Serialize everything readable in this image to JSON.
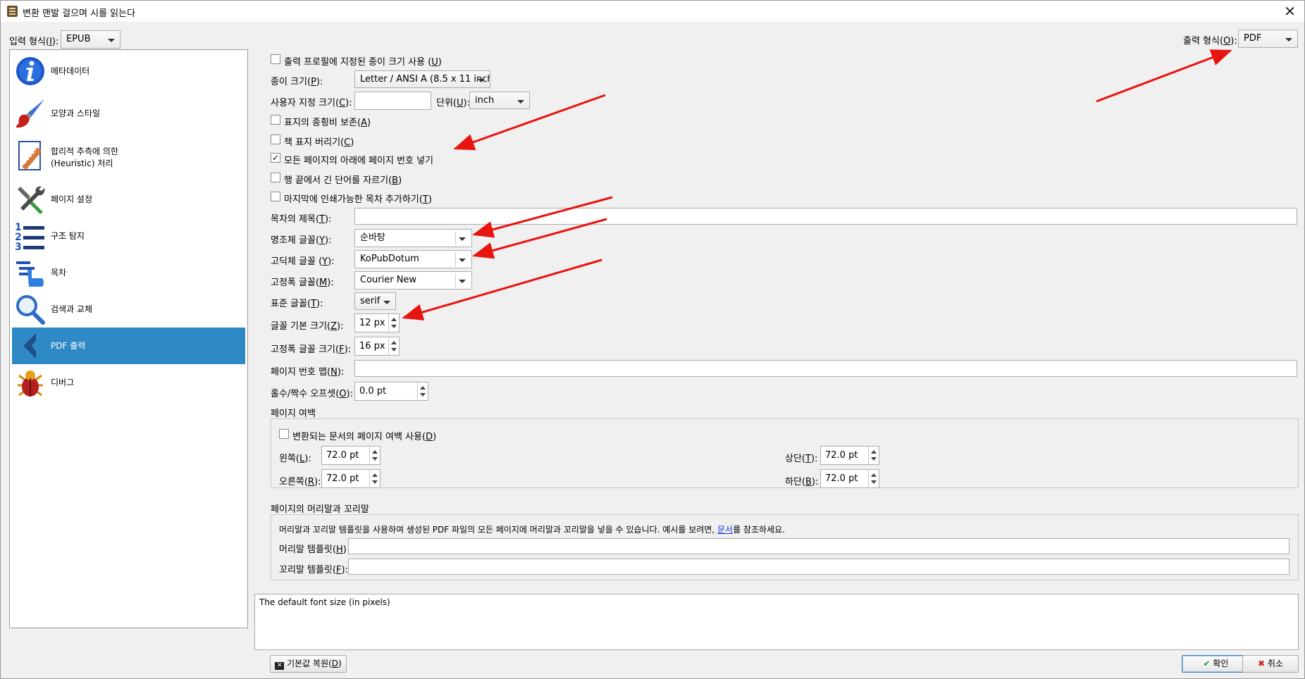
{
  "window": {
    "title": "변환 맨발 걸으며 시를 읽는다"
  },
  "input_format": {
    "label": "입력 형식",
    "shortcut": "I",
    "value": "EPUB"
  },
  "output_format": {
    "label": "출력 형식",
    "shortcut": "O",
    "value": "PDF"
  },
  "sidebar": {
    "items": [
      {
        "label": "메타데이터",
        "icon": "info-icon"
      },
      {
        "label": "모양과 스타일",
        "icon": "paintbrush-icon"
      },
      {
        "label": "합리적 추측에 의한",
        "label2": "(Heuristic) 처리",
        "icon": "heuristic-document-icon"
      },
      {
        "label": "페이지 설정",
        "icon": "tools-icon"
      },
      {
        "label": "구조 탐지",
        "icon": "numbered-list-icon"
      },
      {
        "label": "목차",
        "icon": "toc-hand-icon"
      },
      {
        "label": "검색과 교체",
        "icon": "magnifier-icon"
      },
      {
        "label": "PDF 출력",
        "icon": "back-arrow-icon"
      },
      {
        "label": "디버그",
        "icon": "bug-icon"
      }
    ]
  },
  "form": {
    "use_profile_paper": {
      "label": "출력 프로필에 지정된 종이 크기 사용",
      "shortcut": "U",
      "checked": false
    },
    "paper_size": {
      "label": "종이 크기",
      "shortcut": "P",
      "value": "Letter / ANSI A (8.5 x 11 inch)"
    },
    "custom_size": {
      "label": "사용자 지정 크기",
      "shortcut": "C",
      "value": ""
    },
    "unit": {
      "label": "단위",
      "shortcut": "U",
      "value": "inch"
    },
    "preserve_aspect": {
      "label": "표지의 종횡비 보존",
      "shortcut": "A",
      "checked": false
    },
    "discard_cover": {
      "label": "책 표지 버리기",
      "shortcut": "C",
      "checked": false
    },
    "page_numbers": {
      "label": "모든 페이지의 아래에 페이지 번호 넣기",
      "checked": true
    },
    "break_long_words": {
      "label": "행 끝에서 긴 단어를 자르기",
      "shortcut": "B",
      "checked": false
    },
    "add_toc": {
      "label": "마지막에 인쇄가능한 목차 추가하기",
      "shortcut": "T",
      "checked": false
    },
    "toc_title": {
      "label": "목차의 제목",
      "shortcut": "T",
      "value": ""
    },
    "serif_font": {
      "label": "명조체 글꼴",
      "shortcut": "Y",
      "value": "순바탕"
    },
    "sans_font": {
      "label": "고딕체 글꼴 ",
      "shortcut": "Y",
      "value": "KoPubDotum"
    },
    "mono_font": {
      "label": "고정폭 글꼴",
      "shortcut": "M",
      "value": "Courier New"
    },
    "standard_font": {
      "label": "표준 글꼴",
      "shortcut": "T",
      "value": "serif"
    },
    "base_font_size": {
      "label": "글꼴 기본 크기",
      "shortcut": "Z",
      "value": "12 px"
    },
    "mono_font_size": {
      "label": "고정폭 글꼴 크기",
      "shortcut": "F",
      "value": "16 px"
    },
    "page_number_map": {
      "label": "페이지 번호 맵",
      "shortcut": "N",
      "value": ""
    },
    "odd_even_offset": {
      "label": "홀수/짝수 오프셋",
      "shortcut": "O",
      "value": "0.0 pt"
    }
  },
  "margins": {
    "title": "페이지 여백",
    "use_document_margins": {
      "label": "변환되는 문서의 페이지 여백 사용",
      "shortcut": "D",
      "checked": false
    },
    "left": {
      "label": "왼쪽",
      "shortcut": "L",
      "value": "72.0 pt"
    },
    "right": {
      "label": "오른쪽",
      "shortcut": "R",
      "value": "72.0 pt"
    },
    "top": {
      "label": "상단",
      "shortcut": "T",
      "value": "72.0 pt"
    },
    "bottom": {
      "label": "하단",
      "shortcut": "B",
      "value": "72.0 pt"
    }
  },
  "header_footer": {
    "title": "페이지의 머리말과 꼬리말",
    "description_pre": "머리말과 꼬리말 템플릿을 사용하여 생성된 PDF 파일의 모든 페이지에 머리말과 꼬리말을 넣을 수 있습니다. 예시를 보려면, ",
    "link": "문서",
    "description_post": "를 참조하세요.",
    "header_template": {
      "label": "머리말 템플릿",
      "shortcut": "H",
      "value": ""
    },
    "footer_template": {
      "label": "꼬리말 템플릿",
      "shortcut": "F",
      "value": ""
    }
  },
  "help_text": "The default font size (in pixels)",
  "buttons": {
    "restore_defaults": {
      "label": "기본값 복원",
      "shortcut": "D"
    },
    "ok": "확인",
    "cancel": "취소"
  },
  "colors": {
    "active_nav": "#2f89c4",
    "arrow": "#e8140f",
    "link": "#1a36d6"
  }
}
